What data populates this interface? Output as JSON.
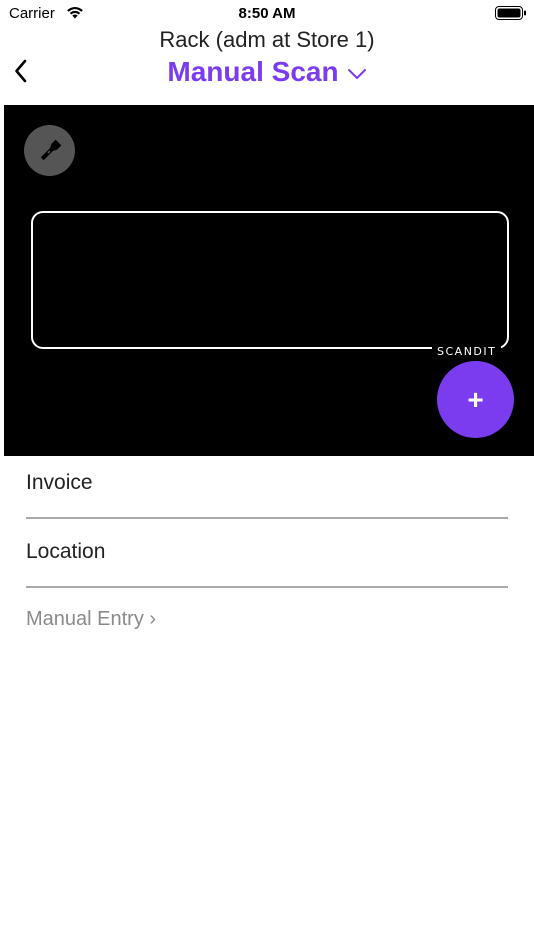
{
  "status_bar": {
    "carrier": "Carrier",
    "time": "8:50 AM"
  },
  "nav": {
    "subtitle": "Rack (adm at Store 1)",
    "title": "Manual Scan",
    "accent_color": "#7b3cf0"
  },
  "camera": {
    "logo_text": "SCANDIT",
    "add_button_label": "+"
  },
  "form": {
    "fields": [
      {
        "label": "Invoice"
      },
      {
        "label": "Location"
      }
    ],
    "manual_entry_label": "Manual Entry ›"
  }
}
